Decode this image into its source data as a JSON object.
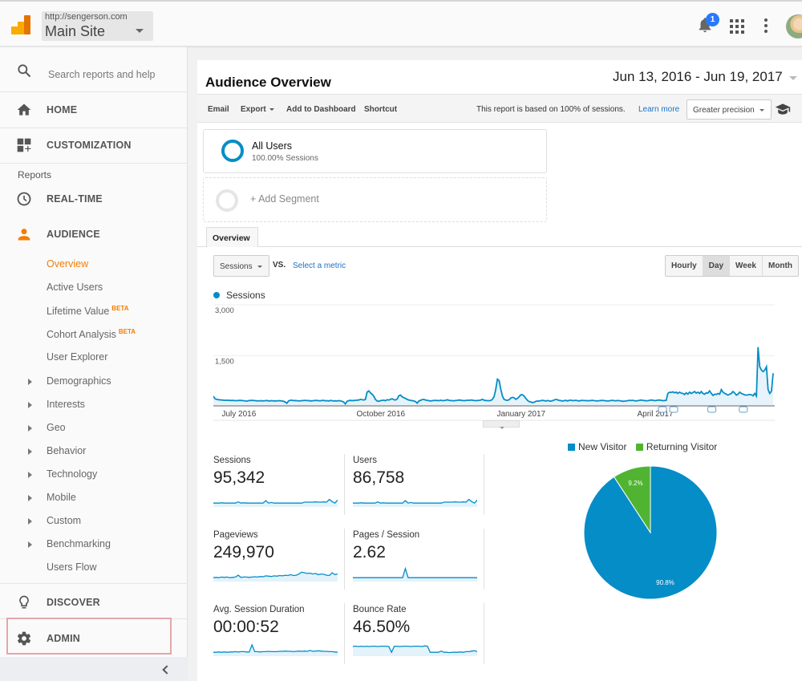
{
  "header": {
    "site_url": "http://sengerson.com",
    "site_name": "Main Site",
    "notification_count": "1",
    "icons": [
      "analytics-logo",
      "bell-icon",
      "apps-grid-icon",
      "more-vert-icon",
      "avatar"
    ]
  },
  "sidebar": {
    "search_placeholder": "Search reports and help",
    "home": "HOME",
    "customization": "CUSTOMIZATION",
    "reports_label": "Reports",
    "realtime": "REAL-TIME",
    "audience": "AUDIENCE",
    "audience_items": [
      {
        "label": "Overview",
        "active": true,
        "expandable": false,
        "beta": ""
      },
      {
        "label": "Active Users",
        "active": false,
        "expandable": false,
        "beta": ""
      },
      {
        "label": "Lifetime Value",
        "active": false,
        "expandable": false,
        "beta": "BETA"
      },
      {
        "label": "Cohort Analysis",
        "active": false,
        "expandable": false,
        "beta": "BETA"
      },
      {
        "label": "User Explorer",
        "active": false,
        "expandable": false,
        "beta": ""
      },
      {
        "label": "Demographics",
        "active": false,
        "expandable": true,
        "beta": ""
      },
      {
        "label": "Interests",
        "active": false,
        "expandable": true,
        "beta": ""
      },
      {
        "label": "Geo",
        "active": false,
        "expandable": true,
        "beta": ""
      },
      {
        "label": "Behavior",
        "active": false,
        "expandable": true,
        "beta": ""
      },
      {
        "label": "Technology",
        "active": false,
        "expandable": true,
        "beta": ""
      },
      {
        "label": "Mobile",
        "active": false,
        "expandable": true,
        "beta": ""
      },
      {
        "label": "Custom",
        "active": false,
        "expandable": true,
        "beta": ""
      },
      {
        "label": "Benchmarking",
        "active": false,
        "expandable": true,
        "beta": ""
      },
      {
        "label": "Users Flow",
        "active": false,
        "expandable": false,
        "beta": ""
      }
    ],
    "discover": "DISCOVER",
    "admin": "ADMIN"
  },
  "report": {
    "title": "Audience Overview",
    "date_range": "Jun 13, 2016 - Jun 19, 2017",
    "toolbar": {
      "email": "Email",
      "export": "Export",
      "add_to_dashboard": "Add to Dashboard",
      "shortcut": "Shortcut",
      "info": "This report is based on 100% of sessions.",
      "learn_more": "Learn more",
      "precision": "Greater precision"
    },
    "segment": {
      "title": "All Users",
      "subtitle": "100.00% Sessions",
      "add_label": "+ Add Segment"
    },
    "tab": "Overview",
    "metric_select": "Sessions",
    "vs": "VS.",
    "select_metric": "Select a metric",
    "granularity": [
      {
        "label": "Hourly",
        "selected": false
      },
      {
        "label": "Day",
        "selected": true
      },
      {
        "label": "Week",
        "selected": false
      },
      {
        "label": "Month",
        "selected": false
      }
    ],
    "scorecards": [
      {
        "label": "Sessions",
        "value": "95,342"
      },
      {
        "label": "Users",
        "value": "86,758"
      },
      {
        "label": "Pageviews",
        "value": "249,970"
      },
      {
        "label": "Pages / Session",
        "value": "2.62"
      },
      {
        "label": "Avg. Session Duration",
        "value": "00:00:52"
      },
      {
        "label": "Bounce Rate",
        "value": "46.50%"
      }
    ]
  },
  "colors": {
    "accent": "#f57c00",
    "series": "#058dc7",
    "returning": "#50b432",
    "link": "#1a73c6"
  },
  "chart_data": [
    {
      "type": "area",
      "title": "",
      "legend": [
        "Sessions"
      ],
      "xlabel": "",
      "ylabel": "",
      "ylim": [
        0,
        3000
      ],
      "yticks": [
        "3,000",
        "1,500"
      ],
      "x_tick_labels": [
        "July 2016",
        "October 2016",
        "January 2017",
        "April 2017"
      ],
      "grid": true,
      "series": [
        {
          "name": "Sessions",
          "values": [
            300,
            220,
            200,
            190,
            185,
            180,
            175,
            170,
            175,
            170,
            168,
            165,
            170,
            160,
            160,
            165,
            170,
            165,
            160,
            150,
            145,
            160,
            165,
            170,
            165,
            160,
            155,
            150,
            160,
            155,
            150,
            160,
            165,
            150,
            155,
            160,
            150,
            155,
            150,
            160,
            155,
            150,
            140,
            120,
            80,
            150,
            170,
            175,
            160,
            165,
            160,
            150,
            155,
            160,
            165,
            170,
            160,
            165,
            150,
            155,
            160,
            170,
            165,
            160,
            155,
            165,
            170,
            155,
            160,
            150,
            165,
            160,
            150,
            155,
            150,
            160,
            155,
            140,
            120,
            60,
            140,
            160,
            170,
            160,
            165,
            170,
            175,
            180,
            200,
            190,
            180,
            200,
            420,
            460,
            400,
            360,
            300,
            200,
            150,
            140,
            160,
            170,
            175,
            160,
            190,
            180,
            200,
            220,
            190,
            180,
            210,
            310,
            330,
            280,
            250,
            230,
            200,
            180,
            170,
            160,
            150,
            130,
            80,
            150,
            170,
            190,
            200,
            180,
            170,
            160,
            150,
            160,
            165,
            170,
            165,
            160,
            175,
            160,
            165,
            170,
            190,
            170,
            165,
            160,
            155,
            165,
            170,
            180,
            175,
            165,
            160,
            165,
            175,
            170,
            180,
            175,
            165,
            160,
            165,
            170,
            180,
            200,
            175,
            165,
            160,
            160,
            165,
            200,
            280,
            500,
            820,
            780,
            520,
            300,
            200,
            180,
            170,
            190,
            240,
            260,
            250,
            200,
            230,
            280,
            340,
            340,
            300,
            230,
            170,
            130,
            120,
            100,
            110,
            140,
            150,
            145,
            160,
            170,
            160,
            150,
            165,
            150,
            145,
            160,
            180,
            200,
            185,
            170,
            160,
            150,
            160,
            170,
            150,
            170,
            175,
            160,
            165,
            170,
            160,
            150,
            165,
            170,
            160,
            165,
            155,
            160,
            165,
            170,
            160,
            155,
            150,
            160,
            165,
            170,
            160,
            155,
            150,
            155,
            165,
            170,
            160,
            155,
            165,
            160,
            150,
            140,
            145,
            150,
            160,
            170,
            165,
            170,
            160,
            150,
            160,
            170,
            180,
            170,
            165,
            155,
            160,
            170,
            180,
            175,
            160,
            165,
            175,
            180,
            170,
            160,
            165,
            170,
            380,
            420,
            410,
            430,
            400,
            420,
            380,
            420,
            390,
            380,
            350,
            400,
            360,
            420,
            380,
            410,
            440,
            390,
            420,
            380,
            440,
            380,
            360,
            400,
            390,
            460,
            380,
            320,
            360,
            350,
            380,
            360,
            500,
            420,
            380,
            360,
            330,
            360,
            380,
            440,
            390,
            330,
            360,
            420,
            380,
            360,
            340,
            330,
            340,
            350,
            340,
            310,
            380,
            300,
            1800,
            1200,
            1100,
            1050,
            1100,
            1200,
            500,
            380,
            450,
            1000
          ]
        }
      ],
      "annotations": [
        "note-marker",
        "note-marker",
        "note-marker",
        "note-marker"
      ]
    },
    {
      "type": "pie",
      "title": "",
      "legend": [
        "New Visitor",
        "Returning Visitor"
      ],
      "legend_position": "top",
      "categories": [
        "New Visitor",
        "Returning Visitor"
      ],
      "values": [
        90.8,
        9.2
      ],
      "labels": [
        "90.8%",
        "9.2%"
      ]
    }
  ]
}
